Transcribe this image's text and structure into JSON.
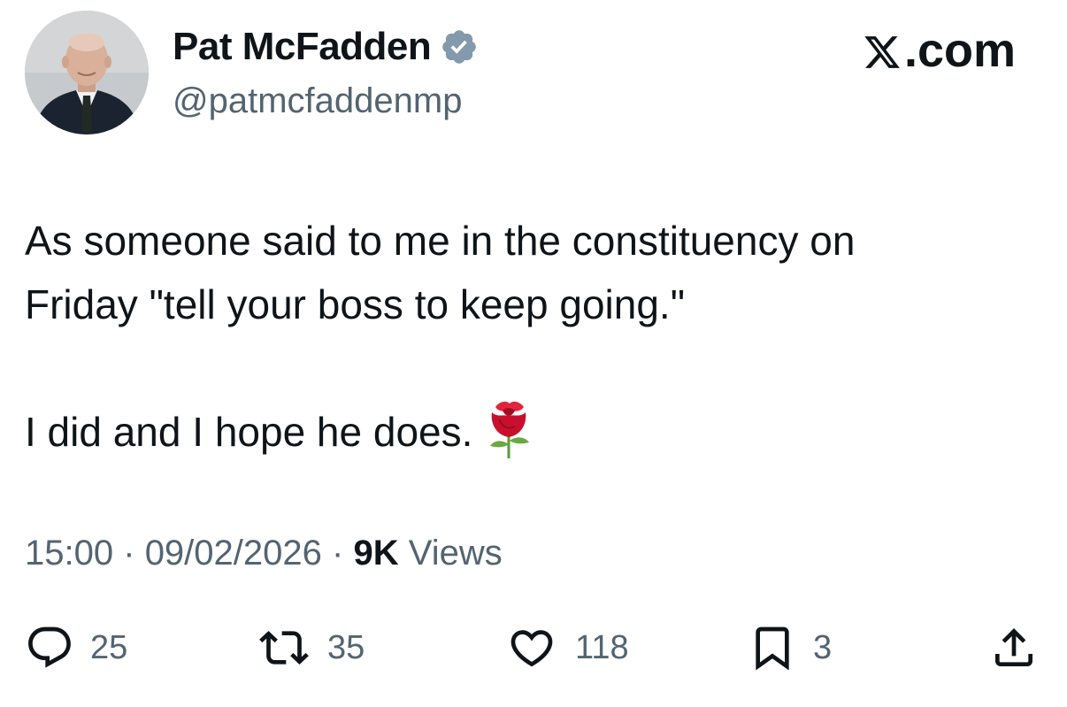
{
  "author": {
    "name": "Pat McFadden",
    "handle": "@patmcfaddenmp",
    "verified": true,
    "verified_color": "#829aab"
  },
  "brand": {
    "label": ".com",
    "logo_icon": "x-logo-icon"
  },
  "tweet": {
    "lines": [
      "As someone said to me in the constituency on",
      "Friday \"tell your boss to keep going.\"",
      "I did and I hope he does."
    ],
    "emoji_icon": "rose-icon"
  },
  "meta": {
    "time": "15:00",
    "separator": "·",
    "date": "09/02/2026",
    "views_count": "9K",
    "views_label": "Views"
  },
  "actions": {
    "replies": "25",
    "reposts": "35",
    "likes": "118",
    "bookmarks": "3"
  },
  "colors": {
    "text": "#0f1419",
    "secondary": "#536471",
    "background": "#ffffff"
  }
}
